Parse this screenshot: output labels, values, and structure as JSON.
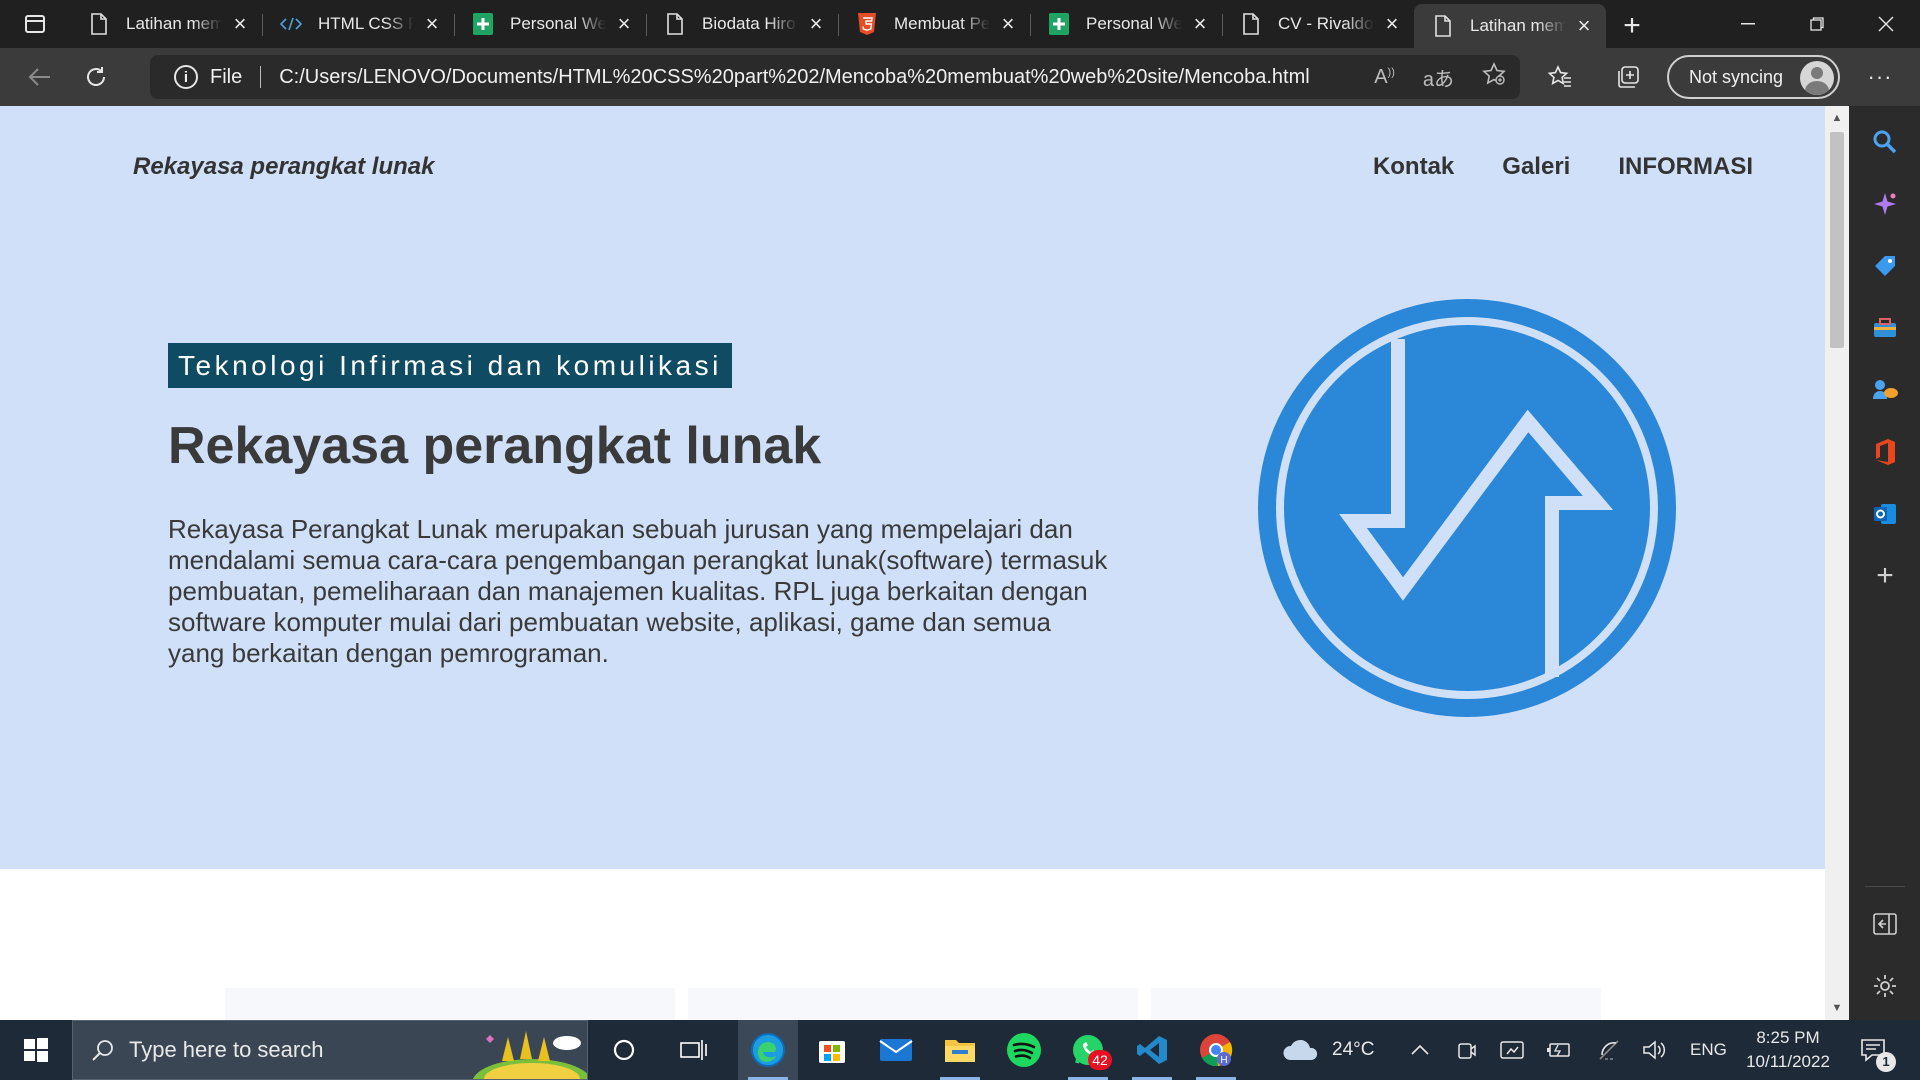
{
  "browser": {
    "tabs": [
      {
        "label": "Latihan membuat",
        "icon": "page-icon"
      },
      {
        "label": "HTML CSS Part",
        "icon": "code-icon"
      },
      {
        "label": "Personal Website",
        "icon": "sheets-icon"
      },
      {
        "label": "Biodata Hiro",
        "icon": "page-icon"
      },
      {
        "label": "Membuat Personal",
        "icon": "html5-icon"
      },
      {
        "label": "Personal Website",
        "icon": "sheets-icon"
      },
      {
        "label": "CV - Rivaldo",
        "icon": "page-icon"
      },
      {
        "label": "Latihan membuat",
        "icon": "page-icon",
        "active": true
      }
    ],
    "address": {
      "scheme_label": "File",
      "url": "C:/Users/LENOVO/Documents/HTML%20CSS%20part%202/Mencoba%20membuat%20web%20site/Mencoba.html"
    },
    "sync_label": "Not syncing"
  },
  "site": {
    "brand": "Rekayasa perangkat lunak",
    "nav": [
      "Kontak",
      "Galeri",
      "INFORMASI"
    ],
    "hero": {
      "tag": "Teknologi Infirmasi dan komulikasi",
      "title": "Rekayasa perangkat lunak",
      "description": "Rekayasa Perangkat Lunak merupakan sebuah jurusan yang mempelajari dan mendalami semua cara-cara pengembangan perangkat lunak(software) termasuk pembuatan, pemeliharaan dan manajemen kualitas. RPL juga berkaitan dengan software komputer mulai dari pembuatan website, aplikasi, game dan semua yang berkaitan dengan pemrograman."
    }
  },
  "taskbar": {
    "search_placeholder": "Type here to search",
    "weather": "24°C",
    "language": "ENG",
    "time": "8:25 PM",
    "date": "10/11/2022",
    "whatsapp_badge": "42",
    "notification_count": "1"
  },
  "colors": {
    "hero_bg": "#cfe0f8",
    "tag_bg": "#0f4b63",
    "logo_blue": "#2b87d8"
  }
}
